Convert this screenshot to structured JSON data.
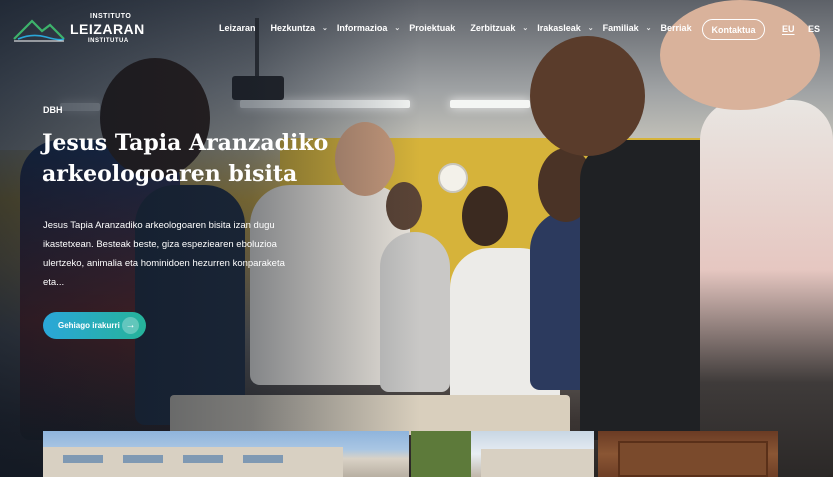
{
  "brand": {
    "line1": "INSTITUTO",
    "line2": "LEIZARAN",
    "line3": "INSTITUTUA"
  },
  "nav": {
    "items": [
      {
        "label": "Leizaran",
        "dropdown": false
      },
      {
        "label": "Hezkuntza",
        "dropdown": true
      },
      {
        "label": "Informazioa",
        "dropdown": true
      },
      {
        "label": "Proiektuak",
        "dropdown": false
      },
      {
        "label": "Zerbitzuak",
        "dropdown": true
      },
      {
        "label": "Irakasleak",
        "dropdown": true
      },
      {
        "label": "Familiak",
        "dropdown": true
      },
      {
        "label": "Berriak",
        "dropdown": false
      }
    ],
    "contact_label": "Kontaktua",
    "languages": [
      {
        "code": "EU",
        "active": true
      },
      {
        "code": "ES",
        "active": false
      }
    ]
  },
  "hero": {
    "tag": "DBH",
    "title": "Jesus Tapia Aranzadiko arkeologoaren bisita",
    "excerpt": "Jesus Tapia Aranzadiko arkeologoaren bisita izan dugu ikastetxean. Besteak beste, giza espeziearen eboluzioa ulertzeko, animalia eta hominidoen hezurren konparaketa eta...",
    "button_label": "Gehiago irakurri",
    "button_icon": "arrow-right-icon"
  },
  "colors": {
    "accent_start": "#2aa7d9",
    "accent_end": "#26b39a",
    "text_on_image": "#ffffff",
    "logo_green": "#3db36b"
  }
}
